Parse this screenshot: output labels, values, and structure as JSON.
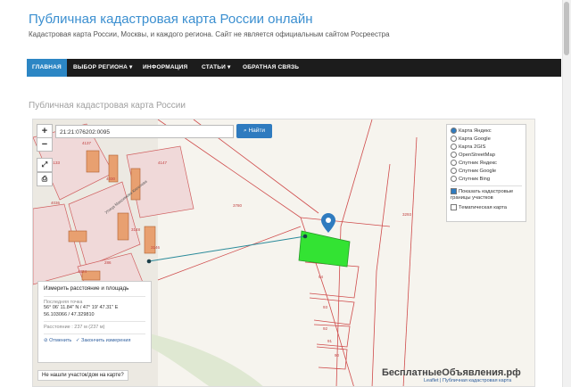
{
  "site": {
    "title": "Публичная кадастровая карта России онлайн",
    "subtitle": "Кадастровая карта России, Москвы, и каждого региона. Сайт не является официальным сайтом Росреестра"
  },
  "nav": {
    "items": [
      "ГЛАВНАЯ",
      "ВЫБОР РЕГИОНА",
      "ИНФОРМАЦИЯ",
      "СТАТЬИ",
      "ОБРАТНАЯ СВЯЗЬ"
    ]
  },
  "page": {
    "heading": "Публичная кадастровая карта России"
  },
  "map": {
    "search_value": "21:21:076202:0095",
    "find_label": "Найти",
    "zoom_in": "+",
    "zoom_out": "−",
    "parcel_labels": [
      "4133",
      "4137",
      "4147",
      "4030",
      "4036",
      "3780",
      "3293",
      "3148",
      "4824",
      "93",
      "94",
      "92",
      "91",
      "90",
      "3146",
      "286"
    ],
    "street_label": "Улица Максимова Киселева"
  },
  "layers": {
    "options": [
      {
        "label": "Карта Яндекс",
        "checked": true
      },
      {
        "label": "Карта Google",
        "checked": false
      },
      {
        "label": "Карта 2GIS",
        "checked": false
      },
      {
        "label": "OpenStreetMap",
        "checked": false
      },
      {
        "label": "Спутник Яндекс",
        "checked": false
      },
      {
        "label": "Спутник Google",
        "checked": false
      },
      {
        "label": "Спутник Bing",
        "checked": false
      }
    ],
    "show_borders": "Показать кадастровые границы участков",
    "thematic": "Тематическая карта"
  },
  "measure": {
    "title": "Измерить расстояние и площадь",
    "last_point_label": "Последняя точка",
    "coords": "56° 06' 11.84\" N / 47° 19' 47.31\" E",
    "coords_decimal": "56.103066 / 47.329810",
    "distance": "Расстояние : 237 м (237 м)",
    "cancel": "Отменить",
    "finish": "Закончить измерения"
  },
  "footer": {
    "not_found": "Не нашли участок/дом на карте?",
    "watermark": "БесплатныеОбъявления.рф",
    "attribution": "Leaflet | Публичная кадастровая карта"
  }
}
